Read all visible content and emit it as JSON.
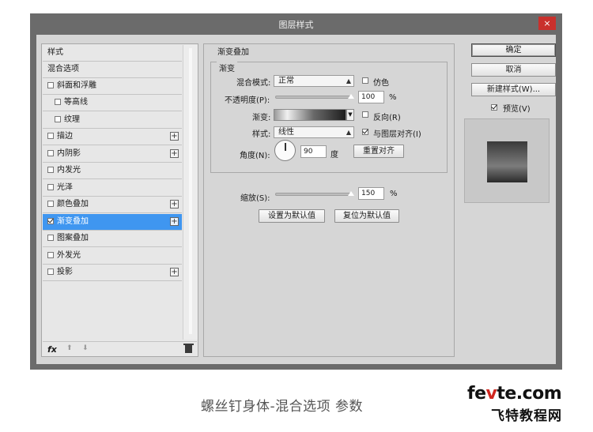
{
  "dialog": {
    "title": "图层样式",
    "close": "×"
  },
  "left_panel": {
    "items": [
      {
        "label": "样式"
      },
      {
        "label": "混合选项"
      },
      {
        "label": "斜面和浮雕",
        "checked": false
      },
      {
        "label": "等高线",
        "checked": false
      },
      {
        "label": "纹理",
        "checked": false
      },
      {
        "label": "描边",
        "checked": false,
        "plus": "+"
      },
      {
        "label": "内阴影",
        "checked": false,
        "plus": "+"
      },
      {
        "label": "内发光",
        "checked": false
      },
      {
        "label": "光泽",
        "checked": false
      },
      {
        "label": "颜色叠加",
        "checked": false,
        "plus": "+"
      },
      {
        "label": "渐变叠加",
        "checked": true,
        "plus": "+",
        "selected": true
      },
      {
        "label": "图案叠加",
        "checked": false
      },
      {
        "label": "外发光",
        "checked": false
      },
      {
        "label": "投影",
        "checked": false,
        "plus": "+"
      }
    ],
    "footer": {
      "fx": "fx",
      "up": "⬆",
      "down": "⬇"
    }
  },
  "gradient_overlay": {
    "section_title": "渐变叠加",
    "group_title": "渐变",
    "blend_mode_label": "混合模式:",
    "blend_mode_value": "正常",
    "dither_label": "仿色",
    "dither_checked": false,
    "opacity_label": "不透明度(P):",
    "opacity_value": "100",
    "opacity_unit": "%",
    "opacity_level": 1.0,
    "gradient_label": "渐变:",
    "reverse_label": "反向(R)",
    "reverse_checked": false,
    "style_label": "样式:",
    "style_value": "线性",
    "align_label": "与图层对齐(I)",
    "align_checked": true,
    "angle_label": "角度(N):",
    "angle_value": "90",
    "angle_unit": "度",
    "reset_align_button": "重置对齐",
    "scale_label": "缩放(S):",
    "scale_value": "150",
    "scale_unit": "%",
    "set_default_button": "设置为默认值",
    "reset_default_button": "复位为默认值"
  },
  "right_panel": {
    "ok_button": "确定",
    "cancel_button": "取消",
    "new_style_button": "新建样式(W)...",
    "preview_label": "预览(V)",
    "preview_checked": true
  },
  "caption": "螺丝钉身体-混合选项 参数",
  "watermark": {
    "line1_a": "fe",
    "line1_b": "v",
    "line1_c": "te.com",
    "line2": "飞特教程网"
  }
}
